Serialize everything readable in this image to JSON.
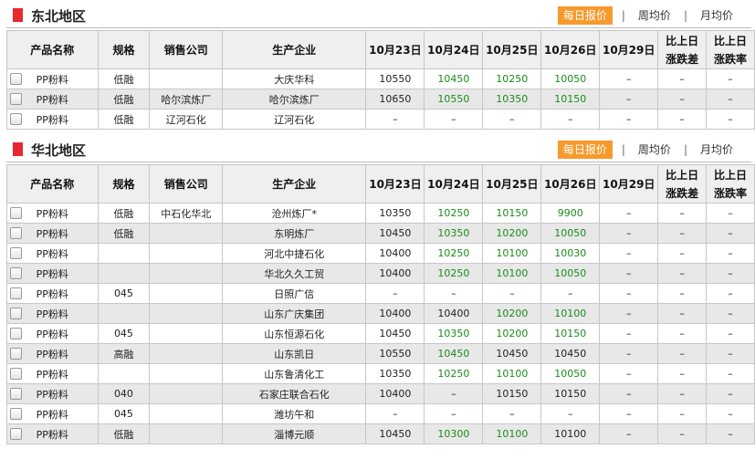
{
  "tabs": [
    "每日报价",
    "周均价",
    "月均价"
  ],
  "headers": [
    "产品名称",
    "规格",
    "销售公司",
    "生产企业",
    "10月23日",
    "10月24日",
    "10月25日",
    "10月26日",
    "10月29日",
    "比上日\n涨跌差",
    "比上日\n涨跌率"
  ],
  "colors": {
    "accent": "#f79a2e",
    "marker": "#e8282f",
    "green": "#1a8a1a"
  },
  "regions": [
    {
      "title": "东北地区",
      "rows": [
        {
          "product": "PP粉料",
          "spec": "低融",
          "company": "",
          "maker": "大庆华科",
          "d23": "10550",
          "d24": "10450",
          "d25": "10250",
          "d26": "10050",
          "d29": "–",
          "diff": "–",
          "rate": "–",
          "green": [
            1,
            2,
            3
          ]
        },
        {
          "product": "PP粉料",
          "spec": "低融",
          "company": "哈尔滨炼厂",
          "maker": "哈尔滨炼厂",
          "d23": "10650",
          "d24": "10550",
          "d25": "10350",
          "d26": "10150",
          "d29": "–",
          "diff": "–",
          "rate": "–",
          "green": [
            1,
            2,
            3
          ]
        },
        {
          "product": "PP粉料",
          "spec": "低融",
          "company": "辽河石化",
          "maker": "辽河石化",
          "d23": "–",
          "d24": "–",
          "d25": "–",
          "d26": "–",
          "d29": "–",
          "diff": "–",
          "rate": "–",
          "green": []
        }
      ]
    },
    {
      "title": "华北地区",
      "rows": [
        {
          "product": "PP粉料",
          "spec": "低融",
          "company": "中石化华北",
          "maker": "沧州炼厂*",
          "d23": "10350",
          "d24": "10250",
          "d25": "10150",
          "d26": "9900",
          "d29": "–",
          "diff": "–",
          "rate": "–",
          "green": [
            1,
            2,
            3
          ]
        },
        {
          "product": "PP粉料",
          "spec": "低融",
          "company": "",
          "maker": "东明炼厂",
          "d23": "10450",
          "d24": "10350",
          "d25": "10200",
          "d26": "10050",
          "d29": "–",
          "diff": "–",
          "rate": "–",
          "green": [
            1,
            2,
            3
          ]
        },
        {
          "product": "PP粉料",
          "spec": "",
          "company": "",
          "maker": "河北中捷石化",
          "d23": "10400",
          "d24": "10250",
          "d25": "10100",
          "d26": "10030",
          "d29": "–",
          "diff": "–",
          "rate": "–",
          "green": [
            1,
            2,
            3
          ]
        },
        {
          "product": "PP粉料",
          "spec": "",
          "company": "",
          "maker": "华北久久工贸",
          "d23": "10400",
          "d24": "10250",
          "d25": "10100",
          "d26": "10050",
          "d29": "–",
          "diff": "–",
          "rate": "–",
          "green": [
            1,
            2,
            3
          ]
        },
        {
          "product": "PP粉料",
          "spec": "045",
          "company": "",
          "maker": "日照广信",
          "d23": "–",
          "d24": "–",
          "d25": "–",
          "d26": "–",
          "d29": "–",
          "diff": "–",
          "rate": "–",
          "green": []
        },
        {
          "product": "PP粉料",
          "spec": "",
          "company": "",
          "maker": "山东广庆集团",
          "d23": "10400",
          "d24": "10400",
          "d25": "10200",
          "d26": "10100",
          "d29": "–",
          "diff": "–",
          "rate": "–",
          "green": [
            2,
            3
          ]
        },
        {
          "product": "PP粉料",
          "spec": "045",
          "company": "",
          "maker": "山东恒源石化",
          "d23": "10450",
          "d24": "10350",
          "d25": "10200",
          "d26": "10150",
          "d29": "–",
          "diff": "–",
          "rate": "–",
          "green": [
            1,
            2,
            3
          ]
        },
        {
          "product": "PP粉料",
          "spec": "高融",
          "company": "",
          "maker": "山东凯日",
          "d23": "10550",
          "d24": "10450",
          "d25": "10450",
          "d26": "10450",
          "d29": "–",
          "diff": "–",
          "rate": "–",
          "green": [
            1
          ]
        },
        {
          "product": "PP粉料",
          "spec": "",
          "company": "",
          "maker": "山东鲁清化工",
          "d23": "10350",
          "d24": "10250",
          "d25": "10100",
          "d26": "10050",
          "d29": "–",
          "diff": "–",
          "rate": "–",
          "green": [
            1,
            2,
            3
          ]
        },
        {
          "product": "PP粉料",
          "spec": "040",
          "company": "",
          "maker": "石家庄联合石化",
          "d23": "10400",
          "d24": "–",
          "d25": "10150",
          "d26": "10150",
          "d29": "–",
          "diff": "–",
          "rate": "–",
          "green": []
        },
        {
          "product": "PP粉料",
          "spec": "045",
          "company": "",
          "maker": "潍坊午和",
          "d23": "–",
          "d24": "–",
          "d25": "–",
          "d26": "–",
          "d29": "–",
          "diff": "–",
          "rate": "–",
          "green": []
        },
        {
          "product": "PP粉料",
          "spec": "低融",
          "company": "",
          "maker": "淄博元顺",
          "d23": "10450",
          "d24": "10300",
          "d25": "10100",
          "d26": "10100",
          "d29": "–",
          "diff": "–",
          "rate": "–",
          "green": [
            1,
            2
          ]
        }
      ]
    }
  ]
}
